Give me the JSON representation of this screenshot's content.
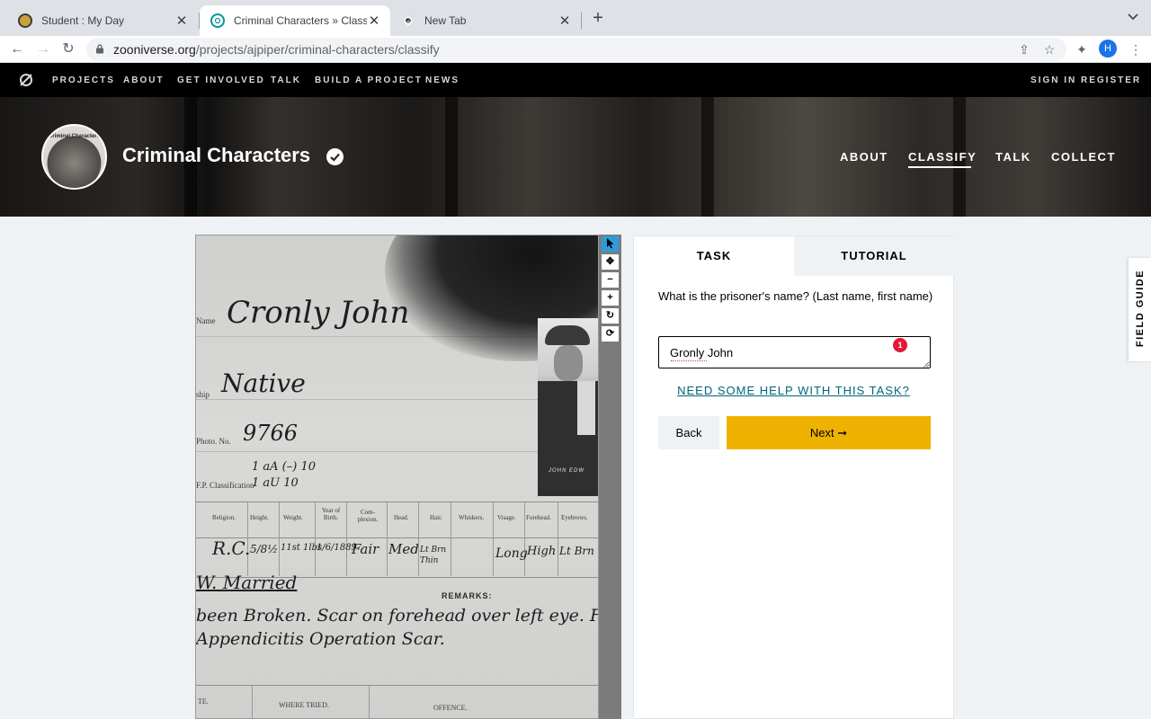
{
  "browser": {
    "tabs": [
      {
        "title": "Student : My Day",
        "active": false
      },
      {
        "title": "Criminal Characters » Classify",
        "active": true
      },
      {
        "title": "New Tab",
        "active": false
      }
    ],
    "new_tab": "+",
    "url_host": "zooniverse.org",
    "url_path": "/projects/ajpiper/criminal-characters/classify",
    "profile_initial": "H"
  },
  "site_nav": {
    "left": [
      "PROJECTS",
      "ABOUT",
      "GET INVOLVED",
      "TALK",
      "BUILD A PROJECT",
      "NEWS"
    ],
    "right": [
      "SIGN IN",
      "REGISTER"
    ]
  },
  "project": {
    "title": "Criminal Characters",
    "avatar_text": "Criminal Characters",
    "nav": [
      "ABOUT",
      "CLASSIFY",
      "TALK",
      "COLLECT"
    ],
    "active_nav": "CLASSIFY"
  },
  "subject": {
    "name_label": "Name",
    "name_value": "Cronly John",
    "ship_label": "ship",
    "ship_value": "Native",
    "photo_label": "Photo. No.",
    "photo_value": "9766",
    "class_label": "F.P. Classification",
    "class_value": "1 aA (–) 10",
    "class_value_2": "1 aU 10",
    "photo_caption": "JOHN EDW",
    "table_headers": [
      "Religion.",
      "Height.",
      "Weight.",
      "Year of Birth.",
      "Com-plexion.",
      "Head.",
      "Hair.",
      "Whiskers.",
      "Visage.",
      "Forehead.",
      "Eyebrows."
    ],
    "table_values": [
      "R.C.",
      "5/8½",
      "11st 1lbs",
      "1/6/1889",
      "Fair",
      "Med",
      "Lt Brn Thin",
      "",
      "Long",
      "High",
      "Lt Brn"
    ],
    "married": "W. Married",
    "remarks_label": "REMARKS:",
    "remarks_line1": "been Broken. Scar on forehead over left eye. Fingers",
    "remarks_line2": "Appendicitis Operation Scar.",
    "footer_headers": [
      "TE.",
      "WHERE TRIED.",
      "OFFENCE."
    ]
  },
  "viewer_tools": [
    "pointer-icon",
    "move-icon",
    "zoom-out-icon",
    "zoom-in-icon",
    "rotate-icon",
    "reset-icon"
  ],
  "task": {
    "tabs": [
      "TASK",
      "TUTORIAL"
    ],
    "question": "What is the prisoner's name? (Last name, first name)",
    "answer_value": "Gronly John",
    "badge_count": "1",
    "help_link": "NEED SOME HELP WITH THIS TASK?",
    "back_label": "Back",
    "next_label": "Next ➞"
  },
  "field_guide": "FIELD GUIDE",
  "colors": {
    "accent_next": "#f0b200",
    "link": "#00647a",
    "badge": "#e5173a",
    "site_nav_bg": "#000000",
    "page_bg": "#eff2f5"
  }
}
